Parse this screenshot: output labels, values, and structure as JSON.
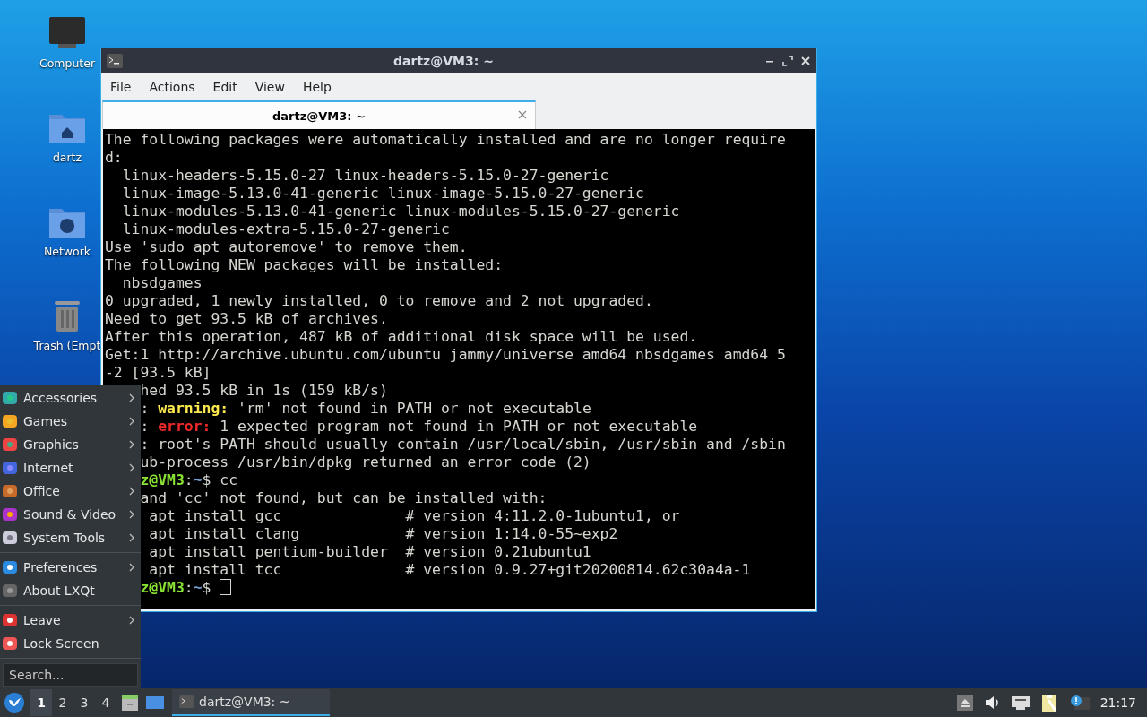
{
  "desktop_icons": [
    "Computer",
    "dartz",
    "Network",
    "Trash (Empt"
  ],
  "window": {
    "title": "dartz@VM3: ~",
    "menu": [
      "File",
      "Actions",
      "Edit",
      "View",
      "Help"
    ],
    "tabs": [
      {
        "label": "dartz@VM3: ~",
        "selected": true
      }
    ],
    "terminal": [
      {
        "clipped": false,
        "segments": [
          {
            "kind": "plain",
            "text": "The following packages were automatically installed and are no longer require"
          }
        ]
      },
      {
        "clipped": false,
        "segments": [
          {
            "kind": "plain",
            "text": "d:"
          }
        ]
      },
      {
        "clipped": false,
        "segments": [
          {
            "kind": "plain",
            "text": "  linux-headers-5.15.0-27 linux-headers-5.15.0-27-generic"
          }
        ]
      },
      {
        "clipped": false,
        "segments": [
          {
            "kind": "plain",
            "text": "  linux-image-5.13.0-41-generic linux-image-5.15.0-27-generic"
          }
        ]
      },
      {
        "clipped": false,
        "segments": [
          {
            "kind": "plain",
            "text": "  linux-modules-5.13.0-41-generic linux-modules-5.15.0-27-generic"
          }
        ]
      },
      {
        "clipped": false,
        "segments": [
          {
            "kind": "plain",
            "text": "  linux-modules-extra-5.15.0-27-generic"
          }
        ]
      },
      {
        "clipped": false,
        "segments": [
          {
            "kind": "plain",
            "text": "Use 'sudo apt autoremove' to remove them."
          }
        ]
      },
      {
        "clipped": false,
        "segments": [
          {
            "kind": "plain",
            "text": "The following NEW packages will be installed:"
          }
        ]
      },
      {
        "clipped": false,
        "segments": [
          {
            "kind": "plain",
            "text": "  nbsdgames"
          }
        ]
      },
      {
        "clipped": false,
        "segments": [
          {
            "kind": "plain",
            "text": "0 upgraded, 1 newly installed, 0 to remove and 2 not upgraded."
          }
        ]
      },
      {
        "clipped": false,
        "segments": [
          {
            "kind": "plain",
            "text": "Need to get 93.5 kB of archives."
          }
        ]
      },
      {
        "clipped": false,
        "segments": [
          {
            "kind": "plain",
            "text": "After this operation, 487 kB of additional disk space will be used."
          }
        ]
      },
      {
        "clipped": false,
        "segments": [
          {
            "kind": "plain",
            "text": "Get:1 http://archive.ubuntu.com/ubuntu jammy/universe amd64 nbsdgames amd64 5"
          }
        ]
      },
      {
        "clipped": false,
        "segments": [
          {
            "kind": "plain",
            "text": "-2 [93.5 kB]"
          }
        ]
      },
      {
        "clipped": true,
        "segments": [
          {
            "kind": "plain",
            "text": "hed 93.5 kB in 1s (159 kB/s)"
          }
        ]
      },
      {
        "clipped": true,
        "segments": [
          {
            "kind": "plain",
            "text": ": "
          },
          {
            "kind": "warning",
            "text": "warning:"
          },
          {
            "kind": "plain",
            "text": " 'rm' not found in PATH or not executable"
          }
        ]
      },
      {
        "clipped": true,
        "segments": [
          {
            "kind": "plain",
            "text": ": "
          },
          {
            "kind": "error",
            "text": "error:"
          },
          {
            "kind": "plain",
            "text": " 1 expected program not found in PATH or not executable"
          }
        ]
      },
      {
        "clipped": true,
        "segments": [
          {
            "kind": "plain",
            "text": ": root's PATH should usually contain /usr/local/sbin, /usr/sbin and /sbin"
          }
        ]
      },
      {
        "clipped": true,
        "segments": [
          {
            "kind": "plain",
            "text": "ub-process /usr/bin/dpkg returned an error code (2)"
          }
        ]
      },
      {
        "clipped": true,
        "segments": [
          {
            "kind": "user",
            "text": "z@VM3"
          },
          {
            "kind": "plain",
            "text": ":"
          },
          {
            "kind": "path",
            "text": "~"
          },
          {
            "kind": "plain",
            "text": "$ cc"
          }
        ]
      },
      {
        "clipped": true,
        "segments": [
          {
            "kind": "plain",
            "text": "and 'cc' not found, but can be installed with:"
          }
        ]
      },
      {
        "clipped": true,
        "segments": [
          {
            "kind": "plain",
            "text": " apt install gcc              # version 4:11.2.0-1ubuntu1, or"
          }
        ]
      },
      {
        "clipped": true,
        "segments": [
          {
            "kind": "plain",
            "text": " apt install clang            # version 1:14.0-55~exp2"
          }
        ]
      },
      {
        "clipped": true,
        "segments": [
          {
            "kind": "plain",
            "text": " apt install pentium-builder  # version 0.21ubuntu1"
          }
        ]
      },
      {
        "clipped": true,
        "segments": [
          {
            "kind": "plain",
            "text": " apt install tcc              # version 0.9.27+git20200814.62c30a4a-1"
          }
        ]
      },
      {
        "clipped": true,
        "segments": [
          {
            "kind": "user",
            "text": "z@VM3"
          },
          {
            "kind": "plain",
            "text": ":"
          },
          {
            "kind": "path",
            "text": "~"
          },
          {
            "kind": "plain",
            "text": "$ "
          }
        ],
        "cursor": true
      }
    ]
  },
  "app_menu": {
    "sections": [
      [
        {
          "label": "Accessories",
          "submenu": true
        },
        {
          "label": "Games",
          "submenu": true
        },
        {
          "label": "Graphics",
          "submenu": true
        },
        {
          "label": "Internet",
          "submenu": true
        },
        {
          "label": "Office",
          "submenu": true
        },
        {
          "label": "Sound & Video",
          "submenu": true
        },
        {
          "label": "System Tools",
          "submenu": true
        }
      ],
      [
        {
          "label": "Preferences",
          "submenu": true
        },
        {
          "label": "About LXQt",
          "submenu": false
        }
      ],
      [
        {
          "label": "Leave",
          "submenu": true
        },
        {
          "label": "Lock Screen",
          "submenu": false
        }
      ]
    ],
    "search": {
      "placeholder": "Search..."
    }
  },
  "taskbar": {
    "desktops": [
      {
        "label": "1",
        "selected": true
      },
      {
        "label": "2",
        "selected": false
      },
      {
        "label": "3",
        "selected": false
      },
      {
        "label": "4",
        "selected": false
      }
    ],
    "tasks": [
      {
        "label": "dartz@VM3: ~",
        "selected": true
      }
    ],
    "clock": "21:17"
  }
}
